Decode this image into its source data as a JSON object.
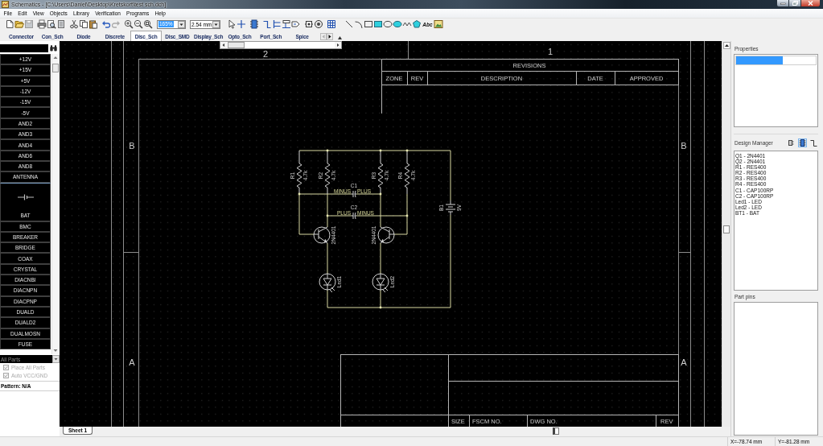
{
  "window": {
    "title": "Schematics - [C:\\Users\\Daniel\\Desktop\\Kretskort\\test sch.dch]"
  },
  "menu": [
    "File",
    "Edit",
    "View",
    "Objects",
    "Library",
    "Verification",
    "Programs",
    "Help"
  ],
  "toolbar": {
    "zoom": "165%",
    "grid": "2.54 mm",
    "text_tool": "Abc"
  },
  "library_tabs": [
    {
      "label": "Connector",
      "selected": false
    },
    {
      "label": "Con_Sch",
      "selected": false
    },
    {
      "label": "Diode",
      "selected": false
    },
    {
      "label": "Discrete",
      "selected": false
    },
    {
      "label": "Disc_Sch",
      "selected": true
    },
    {
      "label": "Disc_SMD",
      "selected": false
    },
    {
      "label": "Display_Sch",
      "selected": false
    },
    {
      "label": "Opto_Sch",
      "selected": false
    },
    {
      "label": "Port_Sch",
      "selected": false
    },
    {
      "label": "Spice",
      "selected": false
    }
  ],
  "parts_panel": {
    "parts": [
      {
        "name": "+12V",
        "selected": false
      },
      {
        "name": "+15V",
        "selected": false
      },
      {
        "name": "+5V",
        "selected": false
      },
      {
        "name": "-12V",
        "selected": false
      },
      {
        "name": "-15V",
        "selected": false
      },
      {
        "name": "-5V",
        "selected": false
      },
      {
        "name": "AND2",
        "selected": false
      },
      {
        "name": "AND3",
        "selected": false
      },
      {
        "name": "AND4",
        "selected": false
      },
      {
        "name": "AND6",
        "selected": false
      },
      {
        "name": "AND8",
        "selected": false
      },
      {
        "name": "ANTENNA",
        "selected": false
      },
      {
        "name": "BAT",
        "selected": true
      },
      {
        "name": "BMC",
        "selected": false
      },
      {
        "name": "BREAKER",
        "selected": false
      },
      {
        "name": "BRIDGE",
        "selected": false
      },
      {
        "name": "COAX",
        "selected": false
      },
      {
        "name": "CRYSTAL",
        "selected": false
      },
      {
        "name": "DIACNBI",
        "selected": false
      },
      {
        "name": "DIACNPN",
        "selected": false
      },
      {
        "name": "DIACPNP",
        "selected": false
      },
      {
        "name": "DUALD",
        "selected": false
      },
      {
        "name": "DUALD2",
        "selected": false
      },
      {
        "name": "DUALMOSN",
        "selected": false
      },
      {
        "name": "FUSE",
        "selected": false
      }
    ],
    "filter": "All Parts",
    "options": [
      {
        "label": "Place All Parts",
        "checked": true,
        "disabled": true
      },
      {
        "label": "Auto VCC/GND",
        "checked": true,
        "disabled": true
      }
    ],
    "pattern": "Pattern: N/A"
  },
  "sheet": {
    "column_zones": [
      "2",
      "1"
    ],
    "left_zones": [
      "B",
      "A"
    ],
    "right_zones": [
      "B",
      "A"
    ],
    "revisions": {
      "title": "REVISIONS",
      "columns": [
        "ZONE",
        "REV",
        "DESCRIPTION",
        "DATE",
        "APPROVED"
      ]
    },
    "title_block": [
      "SIZE",
      "FSCM NO.",
      "DWG NO.",
      "REV"
    ],
    "components": [
      {
        "kind": "resistor",
        "ref": "R1",
        "value": "4.7k"
      },
      {
        "kind": "resistor",
        "ref": "R2",
        "value": "4.7k"
      },
      {
        "kind": "resistor",
        "ref": "R3",
        "value": "4.7k"
      },
      {
        "kind": "resistor",
        "ref": "R4",
        "value": "4.7k"
      },
      {
        "kind": "capacitor",
        "ref": "C1",
        "pins": [
          "MINUS",
          "PLUS"
        ]
      },
      {
        "kind": "capacitor",
        "ref": "C2",
        "pins": [
          "PLUS",
          "MINUS"
        ]
      },
      {
        "kind": "transistor",
        "value": "2N4401"
      },
      {
        "kind": "transistor",
        "value": "2N4401"
      },
      {
        "kind": "led",
        "ref": "Led1"
      },
      {
        "kind": "led",
        "ref": "Led2"
      },
      {
        "kind": "battery",
        "ref": "B1",
        "value": "9V"
      }
    ]
  },
  "sheet_tabs": [
    {
      "label": "Sheet 1",
      "selected": true
    }
  ],
  "properties": {
    "title": "Properties"
  },
  "design_manager": {
    "title": "Design Manager",
    "views": [
      {
        "kind": "parts",
        "selected": false
      },
      {
        "kind": "components",
        "selected": true
      },
      {
        "kind": "nets",
        "selected": false
      }
    ],
    "items": [
      "Q1 - 2N4401",
      "Q2 - 2N4401",
      "R1 - RES400",
      "R2 - RES400",
      "R3 - RES400",
      "R4 - RES400",
      "C1 - CAP100RP",
      "C2 - CAP100RP",
      "Led1 - LED",
      "Led2 - LED",
      "BT1 - BAT"
    ]
  },
  "part_pins": {
    "title": "Part pins"
  },
  "status_bar": [
    "X=-78.74 mm",
    "Y=-81.28 mm"
  ]
}
